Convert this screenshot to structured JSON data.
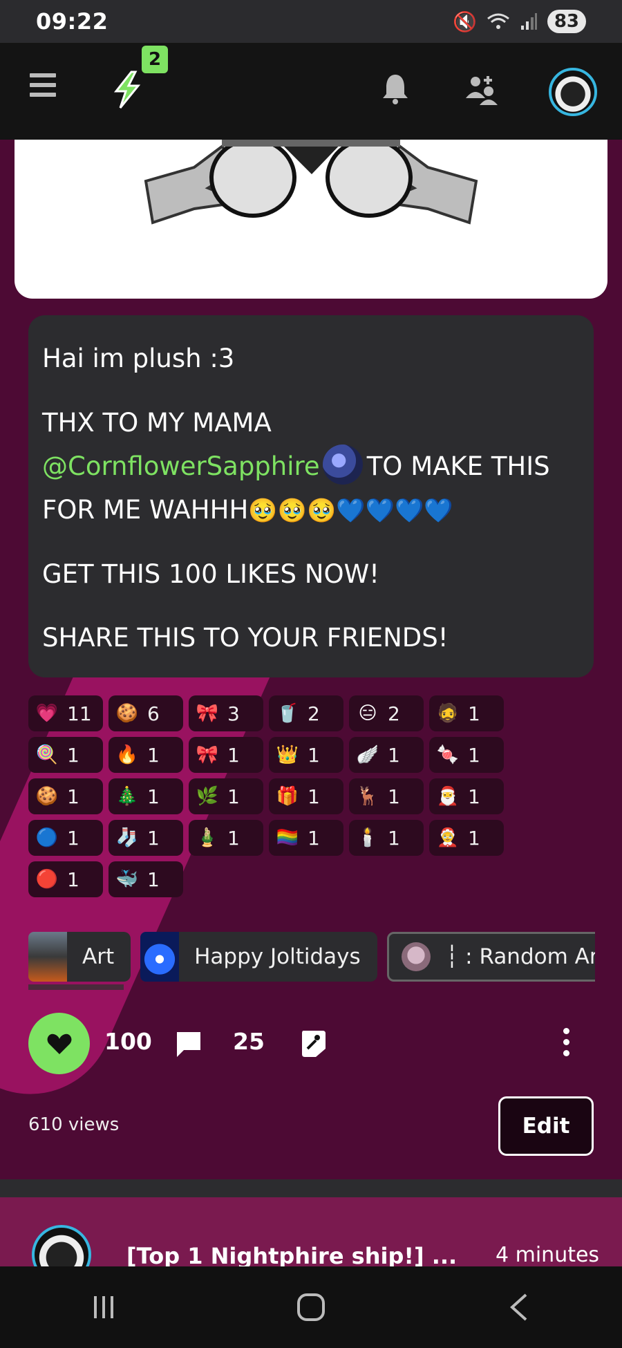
{
  "status_bar": {
    "time": "09:22",
    "battery": "83",
    "icons": [
      "mute-icon",
      "wifi-icon",
      "signal-icon"
    ]
  },
  "top_nav": {
    "notification_badge": "2",
    "icons": [
      "menu-icon",
      "jolt-icon",
      "bell-icon",
      "add-friend-icon",
      "avatar"
    ]
  },
  "post": {
    "lines": [
      "Hai im plush :3",
      "THX TO MY MAMA",
      "@CornflowerSapphire",
      "TO MAKE THIS",
      "FOR ME WAHHH",
      "🥹🥹🥹💙💙💙💙",
      "GET THIS 100 LIKES NOW!",
      "SHARE THIS TO YOUR FRIENDS!"
    ]
  },
  "reactions": [
    {
      "icon": "heart-brain-sticker",
      "count": "11"
    },
    {
      "icon": "cookie-sticker",
      "count": "6"
    },
    {
      "icon": "bow-tie-sticker",
      "count": "3"
    },
    {
      "icon": "iced-coffee-sticker",
      "count": "2"
    },
    {
      "icon": "pink-face-sticker",
      "count": "2"
    },
    {
      "icon": "bearded-face-sticker",
      "count": "1"
    },
    {
      "icon": "lollipop-sticker",
      "count": "1"
    },
    {
      "icon": "fire-sticker",
      "count": "1"
    },
    {
      "icon": "pink-bow-sticker",
      "count": "1"
    },
    {
      "icon": "tiara-sticker",
      "count": "1"
    },
    {
      "icon": "angel-wings-sticker",
      "count": "1"
    },
    {
      "icon": "candy-cane-sticker",
      "count": "1"
    },
    {
      "icon": "gingerbread-sticker",
      "count": "1"
    },
    {
      "icon": "christmas-tree-sticker",
      "count": "1"
    },
    {
      "icon": "holly-sticker",
      "count": "1"
    },
    {
      "icon": "gift-sticker",
      "count": "1"
    },
    {
      "icon": "reindeer-sticker",
      "count": "1"
    },
    {
      "icon": "santa-hat-sticker",
      "count": "1"
    },
    {
      "icon": "ornament-sticker",
      "count": "1"
    },
    {
      "icon": "stocking-sticker",
      "count": "1"
    },
    {
      "icon": "wreath-sticker",
      "count": "1"
    },
    {
      "icon": "pride-flag-sticker",
      "count": "1"
    },
    {
      "icon": "candle-sticker",
      "count": "1"
    },
    {
      "icon": "santa-face-sticker",
      "count": "1"
    },
    {
      "icon": "red-creature-sticker",
      "count": "1"
    },
    {
      "icon": "blue-creature-sticker",
      "count": "1"
    }
  ],
  "tags": [
    "Art",
    "Happy Joltidays",
    "┆ : Random Ar"
  ],
  "actions": {
    "likes": "100",
    "comments": "25"
  },
  "views": "610 views",
  "edit_label": "Edit",
  "next_post": {
    "title": "[Top 1 Nightphire ship!] ...",
    "time": "4 minutes"
  },
  "colors": {
    "accent_green": "#7ee262",
    "background": "#4d0a34",
    "card": "#2c2c2f"
  }
}
